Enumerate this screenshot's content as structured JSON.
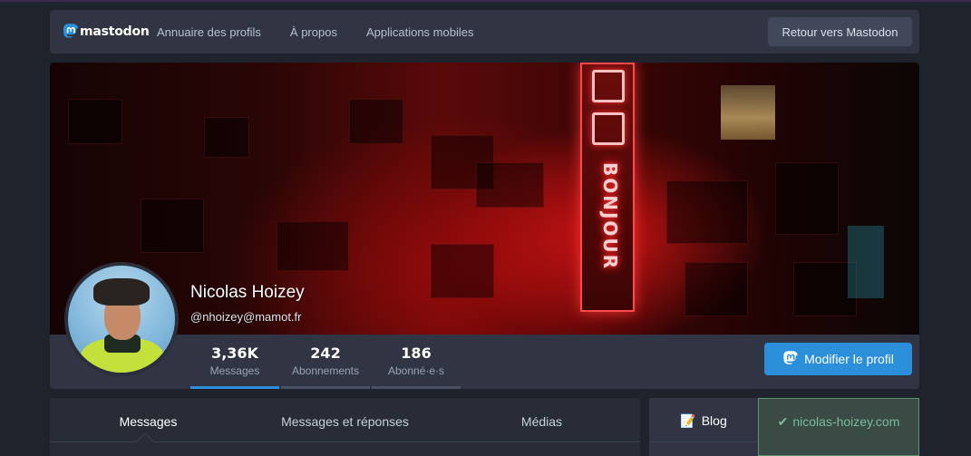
{
  "nav": {
    "logo_text": "mastodon",
    "links": [
      "Annuaire des profils",
      "À propos",
      "Applications mobiles"
    ],
    "back_button": "Retour vers Mastodon"
  },
  "profile": {
    "display_name": "Nicolas Hoizey",
    "handle": "@nhoizey@mamot.fr",
    "banner_sign_text": "BONJOUR",
    "edit_button": "Modifier le profil",
    "stats": [
      {
        "value": "3,36K",
        "label": "Messages",
        "active": true
      },
      {
        "value": "242",
        "label": "Abonnements",
        "active": false
      },
      {
        "value": "186",
        "label": "Abonné·e·s",
        "active": false
      }
    ]
  },
  "tabs": [
    "Messages",
    "Messages et réponses",
    "Médias"
  ],
  "active_tab": "Messages",
  "fields": [
    {
      "name": "Blog",
      "name_icon": "memo-icon",
      "value": "nicolas-hoizey.com",
      "verified": true
    }
  ],
  "colors": {
    "accent": "#2b90d9",
    "verified": "#79bd9a",
    "surface": "#313543",
    "background": "#1f232b"
  }
}
